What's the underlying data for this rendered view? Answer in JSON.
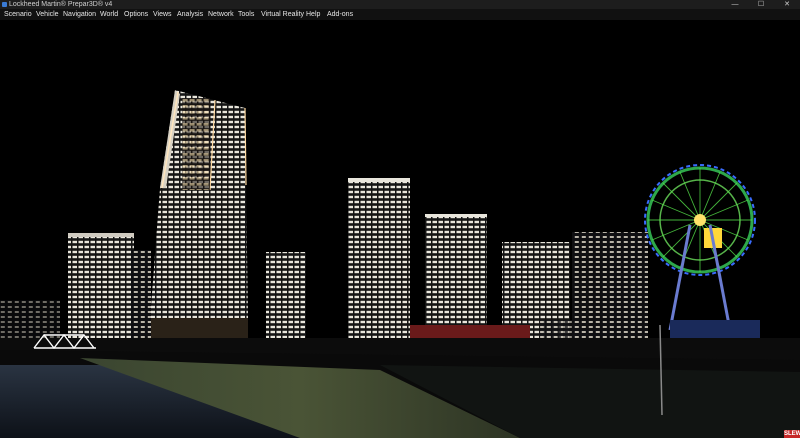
{
  "window": {
    "title": "Lockheed Martin® Prepar3D® v4",
    "minimize_glyph": "—",
    "maximize_glyph": "☐",
    "close_glyph": "✕"
  },
  "menubar": {
    "items": [
      "Scenario",
      "Vehicle",
      "Navigation",
      "World",
      "Options",
      "Views",
      "Analysis",
      "Network",
      "Tools",
      "Virtual Reality",
      "Help",
      "Add-ons"
    ]
  },
  "viewport": {
    "scene": "night-city-skyline",
    "badge": "SLEW",
    "colors": {
      "sky": "#000000",
      "water": "#1a2330",
      "embankment": "#3d4a2a"
    }
  }
}
